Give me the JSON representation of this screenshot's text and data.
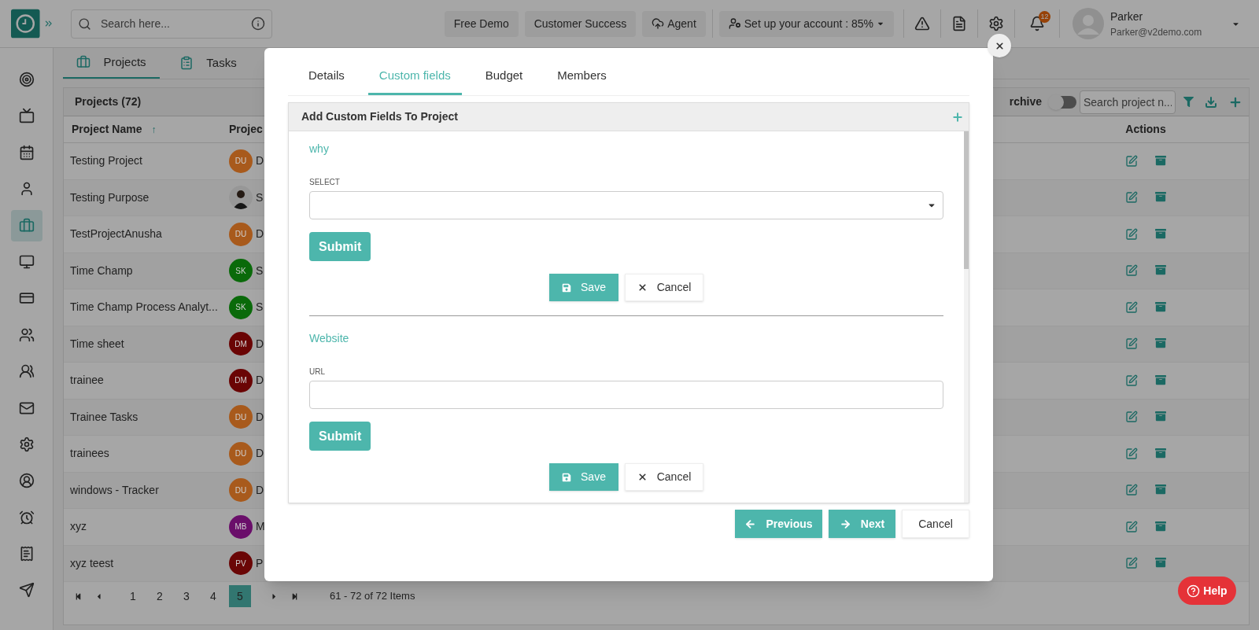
{
  "topbar": {
    "search": {
      "placeholder": "Search here..."
    },
    "buttons": [
      {
        "label": "Free Demo",
        "kind": "plain"
      },
      {
        "label": "Customer Success",
        "kind": "plain"
      },
      {
        "label": "Agent",
        "kind": "cloud"
      }
    ],
    "setup": {
      "label": "Set up your account : 85%"
    },
    "notifications": {
      "badge": "12"
    },
    "user": {
      "name": "Parker",
      "email": "Parker@v2demo.com"
    }
  },
  "sidebar": {
    "items": [
      {
        "kind": "target",
        "selected": false
      },
      {
        "kind": "tv",
        "selected": false
      },
      {
        "kind": "calendar",
        "selected": false
      },
      {
        "kind": "user",
        "selected": false
      },
      {
        "kind": "briefcase",
        "selected": true
      },
      {
        "kind": "monitor",
        "selected": false
      },
      {
        "kind": "card",
        "selected": false
      },
      {
        "kind": "users",
        "selected": false
      },
      {
        "kind": "group",
        "selected": false
      },
      {
        "kind": "mail",
        "selected": false
      },
      {
        "kind": "settings",
        "selected": false
      },
      {
        "kind": "profile",
        "selected": false
      },
      {
        "kind": "alarm",
        "selected": false
      },
      {
        "kind": "invoice",
        "selected": false
      },
      {
        "kind": "send",
        "selected": false
      }
    ]
  },
  "page_tabs": [
    {
      "label": "Projects",
      "kind": "briefcase",
      "selected": true
    },
    {
      "label": "Tasks",
      "kind": "clipboard",
      "selected": false
    }
  ],
  "projects": {
    "title": "Projects",
    "count": "(72)",
    "archive": {
      "label": "rchive",
      "on": false
    },
    "search": {
      "placeholder": "Search project n..."
    },
    "columns": [
      {
        "label": "Project Name",
        "sort_icon": "↑"
      },
      {
        "label": "Projec"
      },
      {
        "label": "Actions"
      }
    ],
    "rows": [
      {
        "name": "Testing Project",
        "avatar": {
          "kind": "initials",
          "initials": "DU",
          "color": "#a85a1c"
        },
        "owner": "D"
      },
      {
        "name": "Testing Purpose",
        "owner": "S"
      },
      {
        "name": "TestProjectAnusha",
        "avatar": {
          "kind": "initials",
          "initials": "DU",
          "color": "#a85a1c"
        },
        "owner": "D"
      },
      {
        "name": "Time Champ",
        "avatar": {
          "kind": "initials",
          "initials": "SK",
          "color": "#0a6a0a"
        },
        "owner": "S"
      },
      {
        "name": "Time Champ Process Analyt...",
        "avatar": {
          "kind": "initials",
          "initials": "SK",
          "color": "#0a6a0a"
        },
        "owner": "S"
      },
      {
        "name": "Time sheet",
        "avatar": {
          "kind": "initials",
          "initials": "DM",
          "color": "#6a0404"
        },
        "owner": "D"
      },
      {
        "name": "trainee",
        "avatar": {
          "kind": "initials",
          "initials": "DM",
          "color": "#6a0404"
        },
        "owner": "D"
      },
      {
        "name": "Trainee Tasks",
        "avatar": {
          "kind": "initials",
          "initials": "DU",
          "color": "#a85a1c"
        },
        "owner": "D"
      },
      {
        "name": "trainees",
        "avatar": {
          "kind": "initials",
          "initials": "DU",
          "color": "#a85a1c"
        },
        "owner": "D"
      },
      {
        "name": "windows - Tracker",
        "avatar": {
          "kind": "initials",
          "initials": "DU",
          "color": "#a85a1c"
        },
        "owner": "D"
      },
      {
        "name": "xyz",
        "avatar": {
          "kind": "initials",
          "initials": "MB",
          "color": "#6a0e6a"
        },
        "owner": "M"
      },
      {
        "name": "xyz teest",
        "avatar": {
          "kind": "initials",
          "initials": "PV",
          "color": "#6a0606"
        },
        "owner": "P"
      }
    ],
    "pagination": {
      "pages": [
        {
          "label": "1",
          "selected": false
        },
        {
          "label": "2",
          "selected": false
        },
        {
          "label": "3",
          "selected": false
        },
        {
          "label": "4",
          "selected": false
        },
        {
          "label": "5",
          "selected": true
        }
      ],
      "summary": "61 - 72 of 72 Items"
    }
  },
  "modal": {
    "tabs": [
      {
        "label": "Details",
        "selected": false
      },
      {
        "label": "Custom fields",
        "selected": true
      },
      {
        "label": "Budget",
        "selected": false
      },
      {
        "label": "Members",
        "selected": false
      }
    ],
    "panel": {
      "title": "Add Custom Fields To Project",
      "fields": [
        {
          "name": "why",
          "kind": "select",
          "label": "SELECT",
          "submit": "Submit",
          "save": "Save",
          "cancel": "Cancel"
        },
        {
          "name": "Website",
          "kind": "url",
          "label": "URL",
          "submit": "Submit",
          "save": "Save",
          "cancel": "Cancel"
        }
      ]
    },
    "footer": {
      "previous": "Previous",
      "next": "Next",
      "cancel": "Cancel"
    }
  },
  "help": {
    "label": "Help"
  }
}
